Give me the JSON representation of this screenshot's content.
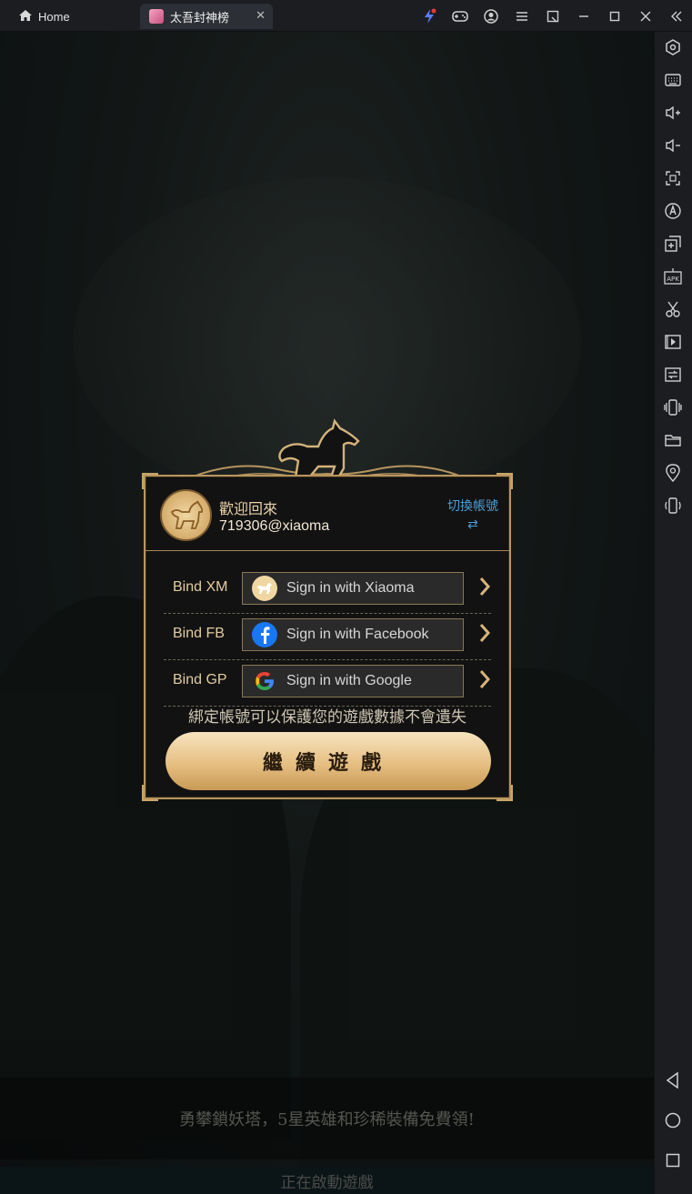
{
  "window": {
    "home_tab": "Home",
    "game_tab": "太吾封神榜",
    "top_icons": [
      "boost-icon",
      "gamepad-icon",
      "account-icon",
      "menu-icon",
      "popout-icon",
      "minimize-icon",
      "maximize-icon",
      "close-icon",
      "collapse-icon"
    ]
  },
  "sidebar": {
    "items": [
      "settings-icon",
      "keyboard-icon",
      "volume-up-icon",
      "volume-down-icon",
      "fullscreen-icon",
      "auto-rotate-icon",
      "multi-instance-icon",
      "apk-install-icon",
      "screenshot-scissors-icon",
      "record-icon",
      "media-manager-icon",
      "shake-icon",
      "folder-icon",
      "location-icon",
      "rotate-icon"
    ],
    "nav": [
      "back-icon",
      "home-circle-icon",
      "recents-square-icon"
    ]
  },
  "dialog": {
    "welcome": "歡迎回來",
    "account": "719306@xiaoma",
    "switch_account": "切換帳號",
    "switch_symbol": "⇄",
    "rows": [
      {
        "label": "Bind XM",
        "button": "Sign in with Xiaoma"
      },
      {
        "label": "Bind FB",
        "button": "Sign in with Facebook"
      },
      {
        "label": "Bind GP",
        "button": "Sign in with Google"
      }
    ],
    "notice": "綁定帳號可以保護您的遊戲數據不會遺失",
    "continue_button": "繼續遊戲"
  },
  "background": {
    "tip": "勇攀鎖妖塔，5星英雄和珍稀裝備免費領!",
    "loading": "正在啟動遊戲"
  },
  "colors": {
    "accent_gold": "#c9a56c",
    "link_blue": "#4a9fd6"
  }
}
